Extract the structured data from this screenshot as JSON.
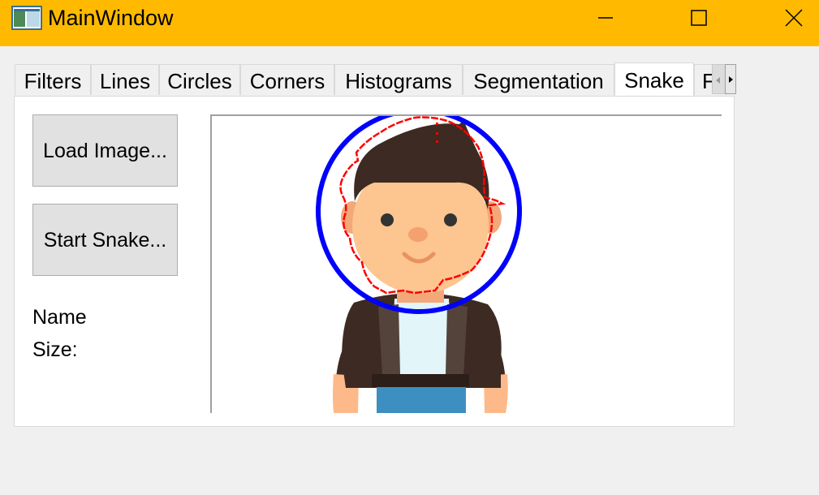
{
  "window": {
    "title": "MainWindow",
    "app_icon": "app-window-icon",
    "controls": [
      "minimize-icon",
      "maximize-icon",
      "close-icon"
    ],
    "titlebar_color": "#ffba00"
  },
  "tabs": [
    {
      "label": "Filters",
      "active": false
    },
    {
      "label": "Lines",
      "active": false
    },
    {
      "label": "Circles",
      "active": false
    },
    {
      "label": "Corners",
      "active": false
    },
    {
      "label": "Histograms",
      "active": false
    },
    {
      "label": "Segmentation",
      "active": false
    },
    {
      "label": "Snake",
      "active": true
    },
    {
      "label": "F",
      "active": false
    }
  ],
  "snake_tab": {
    "load_button": "Load Image...",
    "start_button": "Start Snake...",
    "name_label": "Name",
    "size_label": "Size:",
    "image": {
      "subject": "cartoon-boy",
      "initial_contour_color": "#0000ff",
      "snake_contour_color": "#ff0000"
    }
  }
}
